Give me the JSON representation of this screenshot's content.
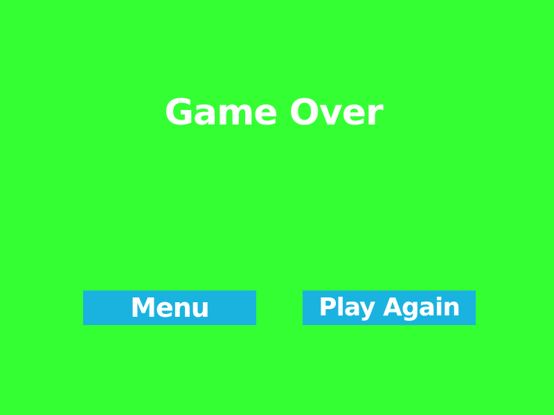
{
  "screen": {
    "background_color": "#33ff33",
    "title": "Game Over"
  },
  "buttons": {
    "color": "#1ab3e0",
    "text_color": "#ffffff",
    "menu_label": "Menu",
    "play_again_label": "Play Again"
  }
}
